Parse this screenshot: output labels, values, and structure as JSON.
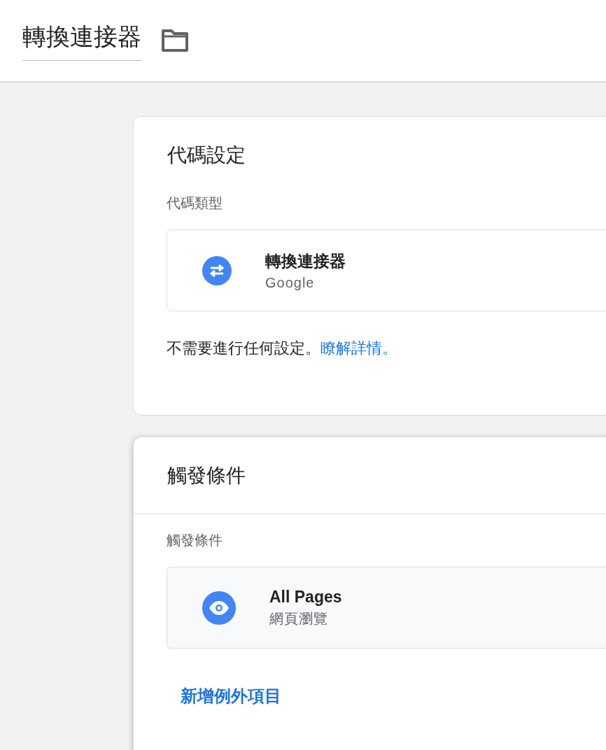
{
  "header": {
    "title": "轉換連接器"
  },
  "tag_configuration": {
    "title": "代碼設定",
    "type_label": "代碼類型",
    "tag_type": {
      "name": "轉換連接器",
      "vendor": "Google"
    },
    "note": "不需要進行任何設定。",
    "link": "瞭解詳情。"
  },
  "triggering": {
    "title": "觸發條件",
    "label": "觸發條件",
    "triggers": [
      {
        "name": "All Pages",
        "type": "網頁瀏覽"
      }
    ],
    "add_exception": "新增例外項目"
  }
}
